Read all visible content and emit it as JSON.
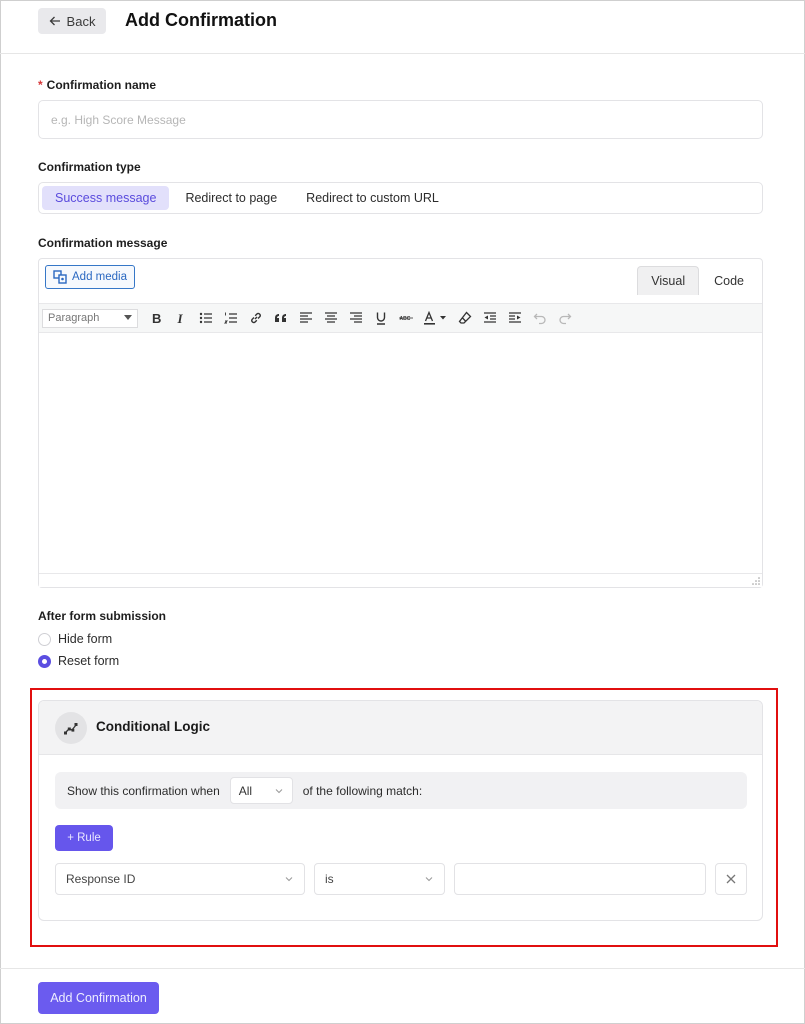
{
  "header": {
    "back_label": "Back",
    "title": "Add Confirmation"
  },
  "confirmation_name": {
    "required_mark": "*",
    "label": "Confirmation name",
    "value": "",
    "placeholder": "e.g. High Score Message"
  },
  "confirmation_type": {
    "label": "Confirmation type",
    "options": [
      "Success message",
      "Redirect to page",
      "Redirect to custom URL"
    ],
    "selected": "Success message"
  },
  "confirmation_message": {
    "label": "Confirmation message",
    "add_media_label": "Add media",
    "mode_tabs": [
      "Visual",
      "Code"
    ],
    "active_mode": "Visual",
    "format_select": "Paragraph",
    "toolbar_icons": [
      "bold-icon",
      "italic-icon",
      "bullet-list-icon",
      "numbered-list-icon",
      "link-icon",
      "blockquote-icon",
      "align-left-icon",
      "align-center-icon",
      "align-right-icon",
      "underline-icon",
      "strikethrough-icon",
      "text-color-icon",
      "clear-formatting-icon",
      "outdent-icon",
      "indent-icon",
      "undo-icon",
      "redo-icon"
    ],
    "content": ""
  },
  "after_submission": {
    "label": "After form submission",
    "options": [
      "Hide form",
      "Reset form"
    ],
    "selected": "Reset form"
  },
  "conditional_logic": {
    "title": "Conditional Logic",
    "match_prefix": "Show this confirmation when",
    "match_value": "All",
    "match_suffix": "of the following match:",
    "add_rule_label": "+ Rule",
    "rules": [
      {
        "field": "Response ID",
        "operator": "is",
        "value": ""
      }
    ]
  },
  "footer": {
    "submit_label": "Add Confirmation"
  },
  "colors": {
    "accent": "#6656ec",
    "accent_light": "#e2e0fb",
    "highlight_border": "#e10f0f",
    "required": "#d63638"
  }
}
